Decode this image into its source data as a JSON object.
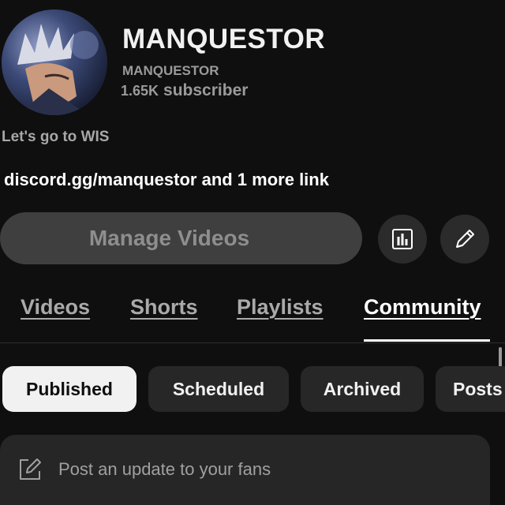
{
  "channel": {
    "name": "MANQUESTOR",
    "handle": "MANQUESTOR",
    "subscriber_count": "1.65K",
    "subscriber_unit": "subscriber",
    "description": "Let's go to WIS",
    "links_text": "discord.gg/manquestor and 1 more link",
    "avatar_icon": "anime-avatar"
  },
  "actions": {
    "manage_videos_label": "Manage Videos",
    "analytics_icon": "bar-chart-icon",
    "edit_icon": "pencil-icon"
  },
  "tabs": [
    {
      "label": "Videos",
      "active": false
    },
    {
      "label": "Shorts",
      "active": false
    },
    {
      "label": "Playlists",
      "active": false
    },
    {
      "label": "Community",
      "active": true
    }
  ],
  "filters": [
    {
      "label": "Published",
      "selected": true
    },
    {
      "label": "Scheduled",
      "selected": false
    },
    {
      "label": "Archived",
      "selected": false
    },
    {
      "label": "Posts",
      "selected": false
    }
  ],
  "composer": {
    "placeholder": "Post an update to your fans",
    "icon": "edit-square-icon"
  },
  "colors": {
    "background": "#0f0f0f",
    "chip": "#272727",
    "chip_selected": "#f1f1f1",
    "manage_button": "#3f3f3f",
    "secondary_text": "#aaaaaa"
  }
}
